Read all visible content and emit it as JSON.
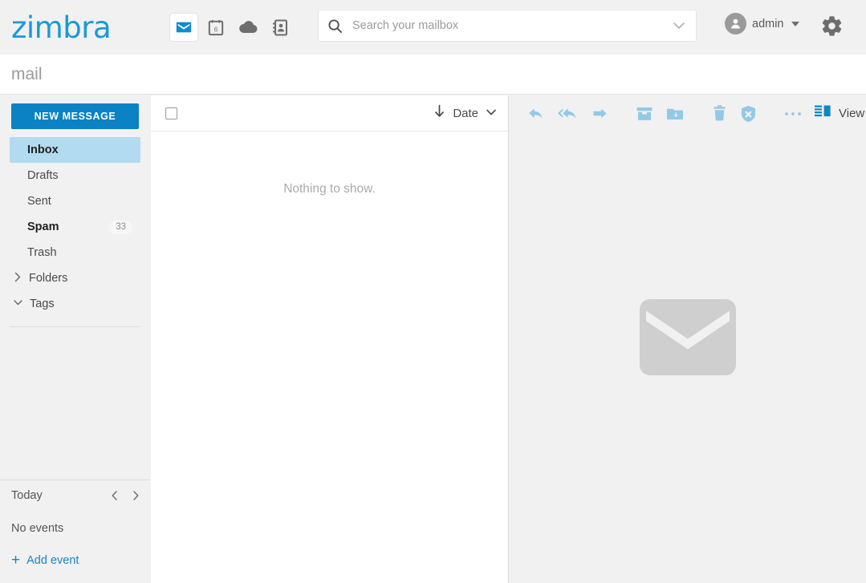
{
  "header": {
    "logo_text": "zimbra",
    "apps": [
      {
        "name": "mail-app-icon",
        "label": "Mail",
        "active": true
      },
      {
        "name": "calendar-app-icon",
        "label": "Calendar",
        "day": "6",
        "active": false
      },
      {
        "name": "briefcase-app-icon",
        "label": "Briefcase",
        "active": false
      },
      {
        "name": "contacts-app-icon",
        "label": "Contacts",
        "active": false
      }
    ],
    "search": {
      "placeholder": "Search your mailbox",
      "value": ""
    },
    "account": {
      "name": "admin"
    },
    "settings_label": "Settings"
  },
  "page": {
    "title": "mail"
  },
  "sidebar": {
    "new_message_label": "NEW MESSAGE",
    "folders": [
      {
        "label": "Inbox",
        "selected": true,
        "bold": true,
        "badge": ""
      },
      {
        "label": "Drafts",
        "selected": false,
        "bold": false,
        "badge": ""
      },
      {
        "label": "Sent",
        "selected": false,
        "bold": false,
        "badge": ""
      },
      {
        "label": "Spam",
        "selected": false,
        "bold": true,
        "badge": "33"
      },
      {
        "label": "Trash",
        "selected": false,
        "bold": false,
        "badge": ""
      }
    ],
    "trees": [
      {
        "label": "Folders",
        "expanded": false,
        "icon": "chevron-right-icon"
      },
      {
        "label": "Tags",
        "expanded": true,
        "icon": "chevron-down-icon"
      }
    ]
  },
  "calendar_panel": {
    "today_label": "Today",
    "prev_label": "Previous",
    "next_label": "Next",
    "empty_text": "No events",
    "add_event_label": "Add event"
  },
  "message_list": {
    "select_all_checked": false,
    "sort_field": "Date",
    "sort_direction": "descending",
    "empty_text": "Nothing to show."
  },
  "reading_pane": {
    "toolbar": [
      {
        "name": "reply-icon",
        "label": "Reply"
      },
      {
        "name": "reply-all-icon",
        "label": "Reply All"
      },
      {
        "name": "forward-icon",
        "label": "Forward"
      },
      {
        "name": "archive-icon",
        "label": "Archive"
      },
      {
        "name": "move-folder-icon",
        "label": "Move"
      },
      {
        "name": "delete-icon",
        "label": "Delete"
      },
      {
        "name": "spam-icon",
        "label": "Mark as Spam"
      },
      {
        "name": "more-icon",
        "label": "More actions"
      }
    ],
    "view_label": "View",
    "placeholder_icon": "envelope-icon"
  },
  "colors": {
    "brand_blue": "#199ad6",
    "button_blue": "#0a82c4",
    "selected_folder": "#b3dbef",
    "toolbar_icon_blue": "#92c9e6",
    "link_blue": "#1a84c7",
    "page_bg": "#f1f1f1"
  }
}
